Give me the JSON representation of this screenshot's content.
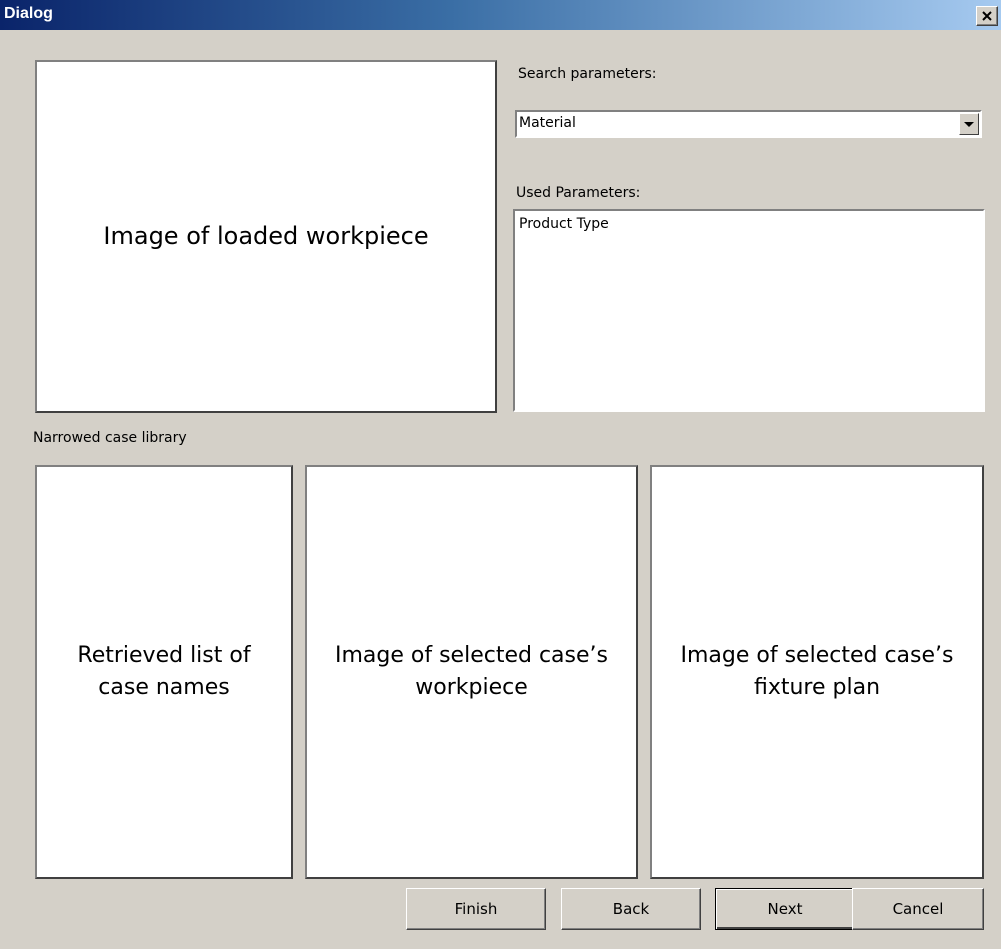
{
  "window": {
    "title": "Dialog",
    "close_icon": "close-icon"
  },
  "top_left_panel": {
    "label": "Image of loaded workpiece"
  },
  "search": {
    "label": "Search parameters:",
    "selected": "Material"
  },
  "used_parameters": {
    "label": "Used Parameters:",
    "items": [
      "Product Type"
    ]
  },
  "narrowed_label": "Narrowed case library",
  "bottom_panels": {
    "list_label": "Retrieved list of\ncase names",
    "workpiece_label": "Image of selected case’s\nworkpiece",
    "fixture_label": "Image of selected case’s\nfixture plan"
  },
  "buttons": {
    "finish": "Finish",
    "back": "Back",
    "next": "Next",
    "cancel": "Cancel"
  },
  "colors": {
    "title_gradient_start": "#0a246a",
    "title_gradient_end": "#a6caf0",
    "dialog_background": "#d4d0c8"
  }
}
